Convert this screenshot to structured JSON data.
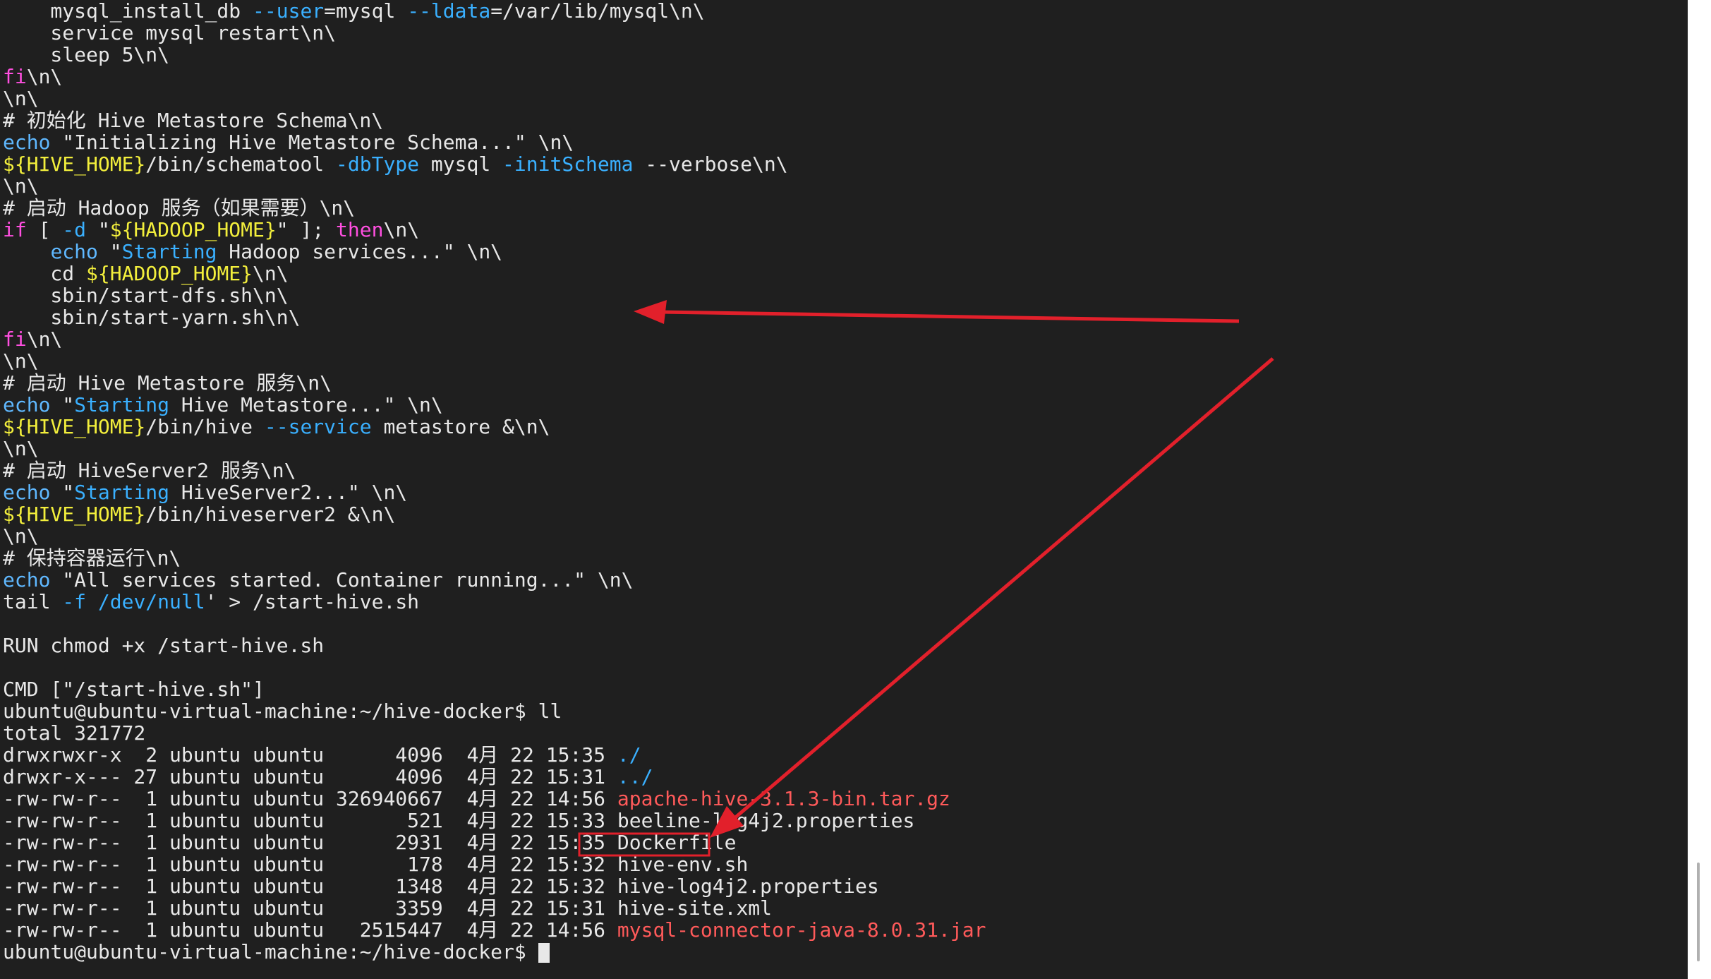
{
  "annotation_color": "#e2202b",
  "terminal": {
    "lines": [
      [
        [
          "    mysql_install_db ",
          "txt"
        ],
        [
          "--user",
          "op"
        ],
        [
          "=mysql ",
          "txt"
        ],
        [
          "--ldata",
          "op"
        ],
        [
          "=/var/lib/mysql\\n\\",
          "txt"
        ]
      ],
      [
        [
          "    service mysql restart\\n\\",
          "txt"
        ]
      ],
      [
        [
          "    sleep 5\\n\\",
          "txt"
        ]
      ],
      [
        [
          "fi",
          "kw"
        ],
        [
          "\\n\\",
          "txt"
        ]
      ],
      [
        [
          "\\n\\",
          "txt"
        ]
      ],
      [
        [
          "# 初始化 Hive Metastore Schema\\n\\",
          "txt"
        ]
      ],
      [
        [
          "echo",
          "cm"
        ],
        [
          " \"Initializing Hive Metastore Schema...\" \\n\\",
          "txt"
        ]
      ],
      [
        [
          "${HIVE_HOME}",
          "vr"
        ],
        [
          "/bin/schematool ",
          "txt"
        ],
        [
          "-dbType",
          "op"
        ],
        [
          " mysql ",
          "txt"
        ],
        [
          "-initSchema",
          "op"
        ],
        [
          " --verbose\\n\\",
          "txt"
        ]
      ],
      [
        [
          "\\n\\",
          "txt"
        ]
      ],
      [
        [
          "# 启动 Hadoop 服务（如果需要）\\n\\",
          "txt"
        ]
      ],
      [
        [
          "if",
          "kw"
        ],
        [
          " [ ",
          "txt"
        ],
        [
          "-d",
          "op"
        ],
        [
          " \"",
          "txt"
        ],
        [
          "${HADOOP_HOME}",
          "vr"
        ],
        [
          "\" ]; ",
          "txt"
        ],
        [
          "then",
          "kw"
        ],
        [
          "\\n\\",
          "txt"
        ]
      ],
      [
        [
          "    ",
          "txt"
        ],
        [
          "echo",
          "cm"
        ],
        [
          " \"",
          "txt"
        ],
        [
          "Starting",
          "st"
        ],
        [
          " Hadoop services...\" \\n\\",
          "txt"
        ]
      ],
      [
        [
          "    cd ",
          "txt"
        ],
        [
          "${HADOOP_HOME}",
          "vr"
        ],
        [
          "\\n\\",
          "txt"
        ]
      ],
      [
        [
          "    sbin/start-dfs.sh\\n\\",
          "txt"
        ]
      ],
      [
        [
          "    sbin/start-yarn.sh\\n\\",
          "txt"
        ]
      ],
      [
        [
          "fi",
          "kw"
        ],
        [
          "\\n\\",
          "txt"
        ]
      ],
      [
        [
          "\\n\\",
          "txt"
        ]
      ],
      [
        [
          "# 启动 Hive Metastore 服务\\n\\",
          "txt"
        ]
      ],
      [
        [
          "echo",
          "cm"
        ],
        [
          " \"",
          "txt"
        ],
        [
          "Starting",
          "st"
        ],
        [
          " Hive Metastore...\" \\n\\",
          "txt"
        ]
      ],
      [
        [
          "${HIVE_HOME}",
          "vr"
        ],
        [
          "/bin/hive ",
          "txt"
        ],
        [
          "--service",
          "op"
        ],
        [
          " metastore &\\n\\",
          "txt"
        ]
      ],
      [
        [
          "\\n\\",
          "txt"
        ]
      ],
      [
        [
          "# 启动 HiveServer2 服务\\n\\",
          "txt"
        ]
      ],
      [
        [
          "echo",
          "cm"
        ],
        [
          " \"",
          "txt"
        ],
        [
          "Starting",
          "st"
        ],
        [
          " HiveServer2...\" \\n\\",
          "txt"
        ]
      ],
      [
        [
          "${HIVE_HOME}",
          "vr"
        ],
        [
          "/bin/hiveserver2 &\\n\\",
          "txt"
        ]
      ],
      [
        [
          "\\n\\",
          "txt"
        ]
      ],
      [
        [
          "# 保持容器运行\\n\\",
          "txt"
        ]
      ],
      [
        [
          "echo",
          "cm"
        ],
        [
          " \"All services started. Container running...\" \\n\\",
          "txt"
        ]
      ],
      [
        [
          "tail ",
          "txt"
        ],
        [
          "-f",
          "op"
        ],
        [
          " ",
          "txt"
        ],
        [
          "/dev/null",
          "dir"
        ],
        [
          "' > /start-hive.sh",
          "txt"
        ]
      ],
      [
        [
          "",
          "txt"
        ]
      ],
      [
        [
          "RUN chmod +x /start-hive.sh",
          "txt"
        ]
      ],
      [
        [
          "",
          "txt"
        ]
      ],
      [
        [
          "CMD [\"/start-hive.sh\"]",
          "txt"
        ]
      ],
      [
        [
          "ubuntu@ubuntu-virtual-machine:~/hive-docker$ ll",
          "txt"
        ]
      ],
      [
        [
          "total 321772",
          "txt"
        ]
      ],
      [
        [
          "drwxrwxr-x  2 ubuntu ubuntu      4096  4月 22 15:35 ",
          "txt"
        ],
        [
          "./",
          "dir"
        ]
      ],
      [
        [
          "drwxr-x--- 27 ubuntu ubuntu      4096  4月 22 15:31 ",
          "txt"
        ],
        [
          "../",
          "dir"
        ]
      ],
      [
        [
          "-rw-rw-r--  1 ubuntu ubuntu 326940667  4月 22 14:56 ",
          "txt"
        ],
        [
          "apache-hive-3.1.3-bin.tar.gz",
          "arc"
        ]
      ],
      [
        [
          "-rw-rw-r--  1 ubuntu ubuntu       521  4月 22 15:33 beeline-log4j2.properties",
          "txt"
        ]
      ],
      [
        [
          "-rw-rw-r--  1 ubuntu ubuntu      2931  4月 22 15:35 ",
          "txt"
        ],
        [
          "Dockerfile",
          "txt"
        ]
      ],
      [
        [
          "-rw-rw-r--  1 ubuntu ubuntu       178  4月 22 15:32 hive-env.sh",
          "txt"
        ]
      ],
      [
        [
          "-rw-rw-r--  1 ubuntu ubuntu      1348  4月 22 15:32 hive-log4j2.properties",
          "txt"
        ]
      ],
      [
        [
          "-rw-rw-r--  1 ubuntu ubuntu      3359  4月 22 15:31 hive-site.xml",
          "txt"
        ]
      ],
      [
        [
          "-rw-rw-r--  1 ubuntu ubuntu   2515447  4月 22 14:56 ",
          "txt"
        ],
        [
          "mysql-connector-java-8.0.31.jar",
          "arc"
        ]
      ],
      [
        [
          "ubuntu@ubuntu-virtual-machine:~/hive-docker$ ",
          "txt"
        ]
      ]
    ]
  }
}
